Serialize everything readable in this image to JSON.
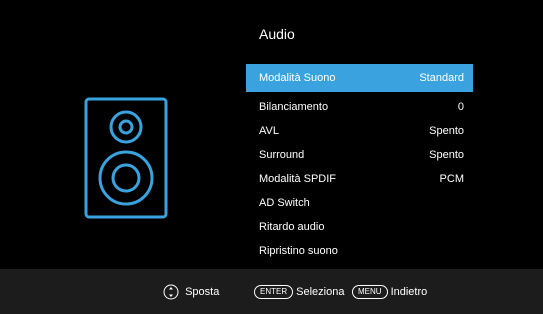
{
  "menu_title": "Audio",
  "accent_color": "#3aa3df",
  "speaker_icon": "speaker-icon",
  "items": [
    {
      "label": "Modalità Suono",
      "value": "Standard"
    },
    {
      "label": "Bilanciamento",
      "value": "0"
    },
    {
      "label": "AVL",
      "value": "Spento"
    },
    {
      "label": "Surround",
      "value": "Spento"
    },
    {
      "label": "Modalità SPDIF",
      "value": "PCM"
    },
    {
      "label": "AD Switch",
      "value": ""
    },
    {
      "label": "Ritardo audio",
      "value": ""
    },
    {
      "label": "Ripristino suono",
      "value": ""
    }
  ],
  "footer": {
    "move": {
      "icon": "navigation-arrows-icon",
      "label": "Sposta"
    },
    "select": {
      "key": "ENTER",
      "label": "Seleziona"
    },
    "back": {
      "key": "MENU",
      "label": "Indietro"
    }
  }
}
